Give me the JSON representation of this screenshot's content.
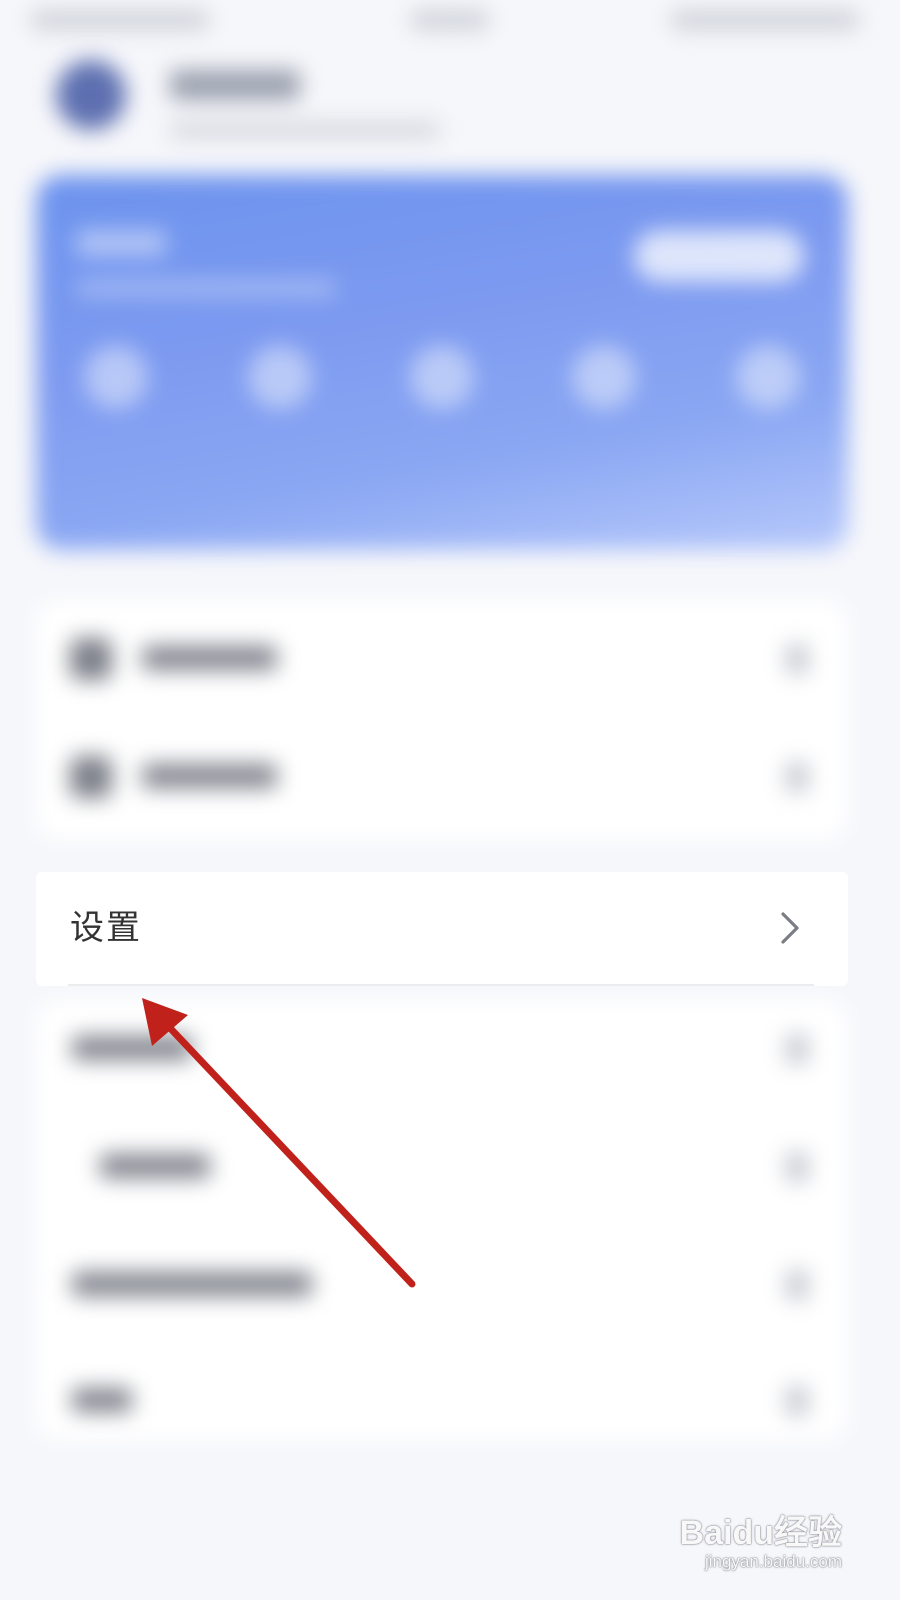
{
  "settings_row": {
    "label": "设置",
    "chevron_icon": "chevron-right-icon"
  },
  "annotation": {
    "arrow_color": "#c0221b",
    "target": "settings_row"
  },
  "watermark": {
    "logo": "Baidu经验",
    "url": "jingyan.baidu.com"
  },
  "colors": {
    "banner_accent": "#7d9af0",
    "background": "#f6f7fb"
  }
}
